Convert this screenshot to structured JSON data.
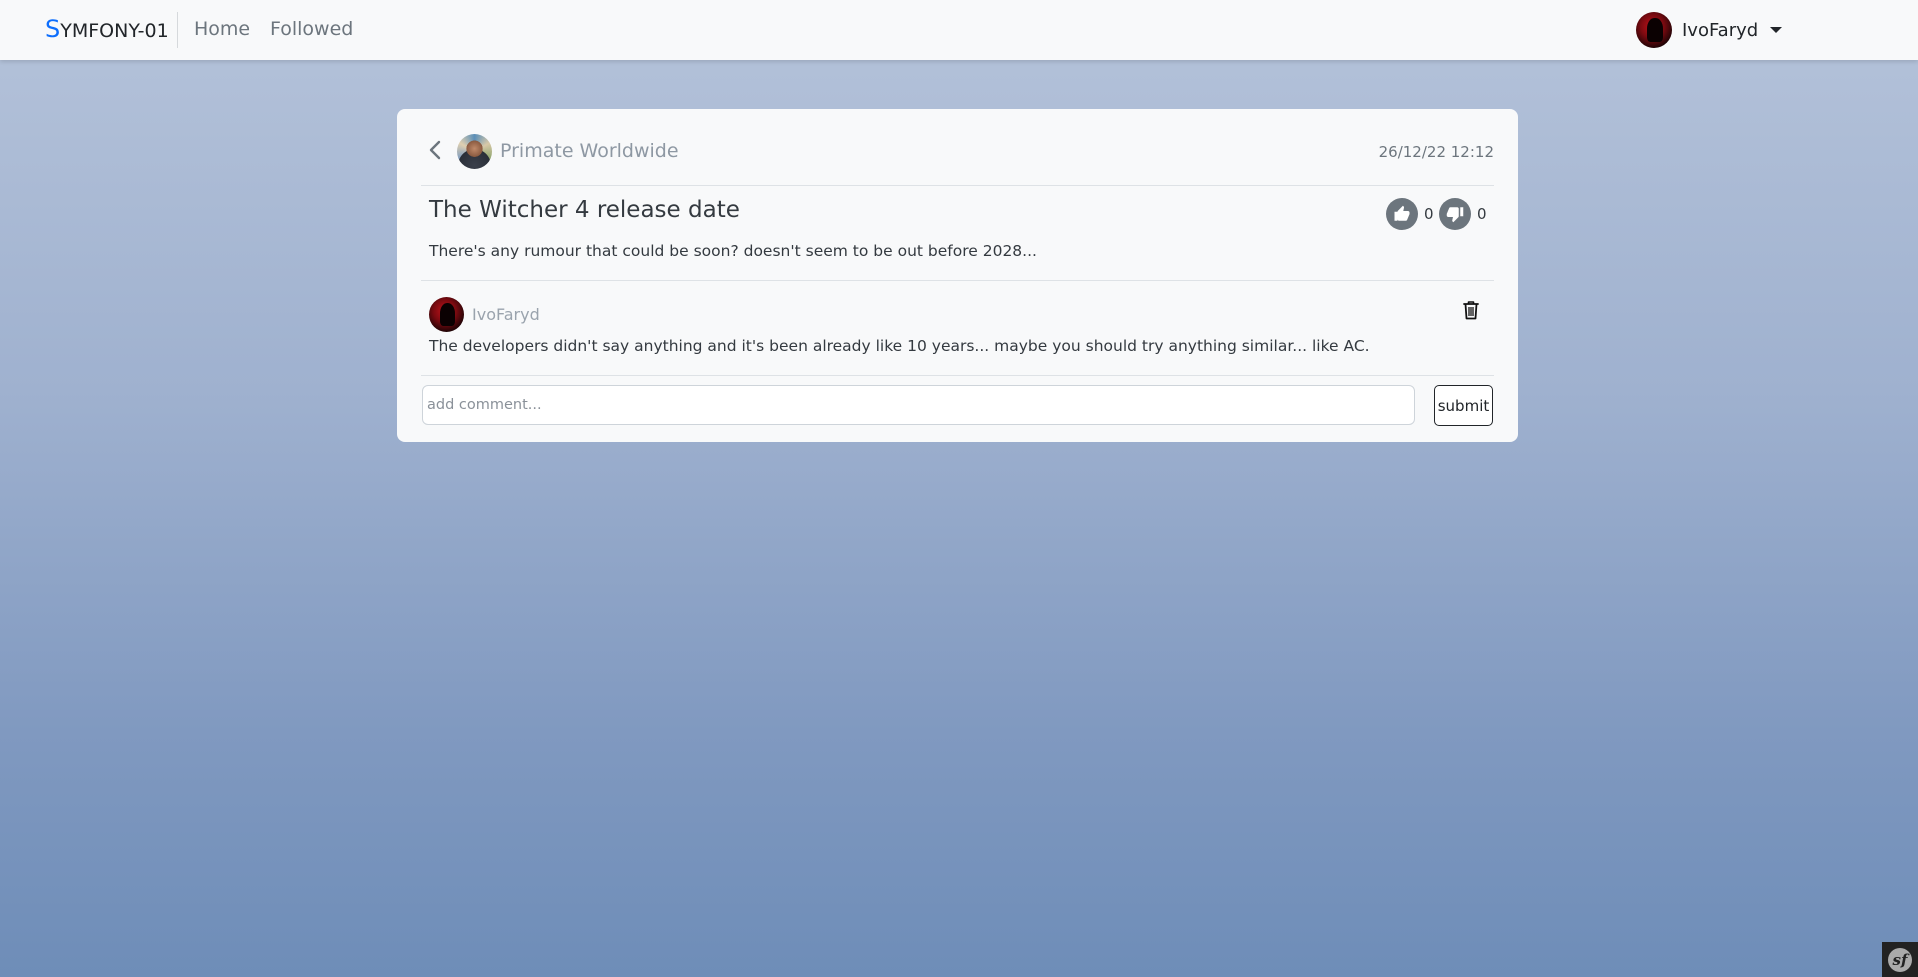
{
  "navbar": {
    "brand_first": "S",
    "brand_rest": "YMFONY-01",
    "home_label": "Home",
    "followed_label": "Followed",
    "username": "IvoFaryd"
  },
  "post": {
    "group_name": "Primate Worldwide",
    "date": "26/12/22 12:12",
    "title": "The Witcher 4 release date",
    "body": "There's any rumour that could be soon? doesn't seem to be out before 2028...",
    "likes": "0",
    "dislikes": "0"
  },
  "comments": [
    {
      "author": "IvoFaryd",
      "text": "The developers didn't say anything and it's been already like 10 years... maybe you should try anything similar... like AC."
    }
  ],
  "comment_form": {
    "placeholder": "add comment...",
    "value": "",
    "submit_label": "submit"
  },
  "colors": {
    "brand_accent": "#0d6efd",
    "background_top": "#b5c3da",
    "background_bottom": "#6e8db8",
    "vote_button": "#6c757d"
  },
  "icons": {
    "back": "chevron-left-icon",
    "like": "thumbs-up-icon",
    "dislike": "thumbs-down-icon",
    "delete": "trash-icon",
    "dropdown": "caret-down-icon",
    "toolbar": "symfony-logo-icon"
  }
}
